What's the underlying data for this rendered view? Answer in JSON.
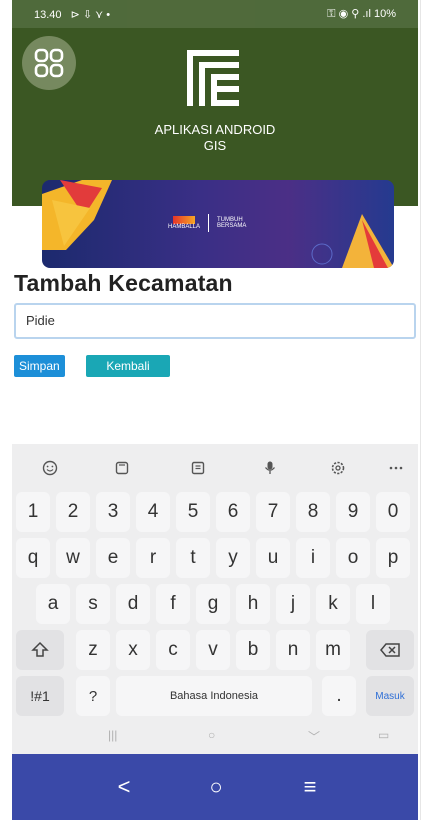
{
  "status_bar": {
    "time": "13.40",
    "left_icons": "⊳ ⇩ ⋎ •",
    "right_text": "⚿ ◉ ⚲ .ıl 10%"
  },
  "header": {
    "app_name_line1": "APLIKASI ANDROID",
    "app_name_line2": "GIS",
    "menu_icon": "grid-icon"
  },
  "banner": {
    "left_text": "HAMBALLA",
    "right_text_line1": "TUMBUH",
    "right_text_line2": "BERSAMA"
  },
  "form": {
    "title": "Tambah Kecamatan",
    "input_value": "Pidie"
  },
  "buttons": {
    "save": "Simpan",
    "back": "Kembali"
  },
  "keyboard": {
    "toolbar": [
      "smile-icon",
      "clipboard-icon",
      "text-mode-icon",
      "mic-icon",
      "settings-icon",
      "more-icon"
    ],
    "row_numbers": [
      "1",
      "2",
      "3",
      "4",
      "5",
      "6",
      "7",
      "8",
      "9",
      "0"
    ],
    "row1": [
      "q",
      "w",
      "e",
      "r",
      "t",
      "y",
      "u",
      "i",
      "o",
      "p"
    ],
    "row2": [
      "a",
      "s",
      "d",
      "f",
      "g",
      "h",
      "j",
      "k",
      "l"
    ],
    "row3": [
      "z",
      "x",
      "c",
      "v",
      "b",
      "n",
      "m"
    ],
    "bottom": {
      "symbols": "!#1",
      "question": "?",
      "space": "Bahasa Indonesia",
      "dot": ".",
      "enter": "Masuk"
    }
  },
  "nav": {
    "back": "<",
    "home": "○",
    "recents": "≡"
  },
  "colors": {
    "header_bg": "#3b5723",
    "save_button": "#1d8fd8",
    "back_button": "#1aa7b5",
    "nav_bg": "#3a49a8"
  }
}
